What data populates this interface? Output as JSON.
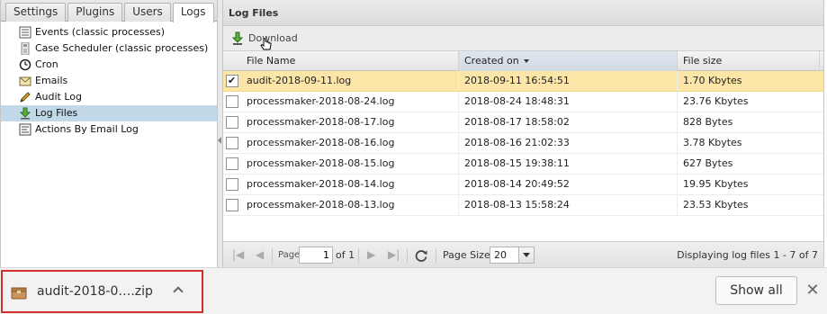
{
  "tabs": [
    "Settings",
    "Plugins",
    "Users",
    "Logs"
  ],
  "active_tab": "Logs",
  "tree": [
    {
      "label": "Events (classic processes)",
      "icon": "events-list-icon"
    },
    {
      "label": "Case Scheduler (classic processes)",
      "icon": "scheduler-icon"
    },
    {
      "label": "Cron",
      "icon": "clock-icon"
    },
    {
      "label": "Emails",
      "icon": "envelope-icon"
    },
    {
      "label": "Audit Log",
      "icon": "pencil-icon"
    },
    {
      "label": "Log Files",
      "icon": "download-icon"
    },
    {
      "label": "Actions By Email Log",
      "icon": "email-log-icon"
    }
  ],
  "selected_tree_item": "Log Files",
  "panel": {
    "title": "Log Files",
    "download_label": "Download"
  },
  "grid": {
    "columns": [
      "File Name",
      "Created on",
      "File size"
    ],
    "rows": [
      {
        "name": "audit-2018-09-11.log",
        "created": "2018-09-11 16:54:51",
        "size": "1.70 Kbytes",
        "checked": true
      },
      {
        "name": "processmaker-2018-08-24.log",
        "created": "2018-08-24 18:48:31",
        "size": "23.76 Kbytes",
        "checked": false
      },
      {
        "name": "processmaker-2018-08-17.log",
        "created": "2018-08-17 18:58:02",
        "size": "828 Bytes",
        "checked": false
      },
      {
        "name": "processmaker-2018-08-16.log",
        "created": "2018-08-16 21:02:33",
        "size": "3.78 Kbytes",
        "checked": false
      },
      {
        "name": "processmaker-2018-08-15.log",
        "created": "2018-08-15 19:38:11",
        "size": "627 Bytes",
        "checked": false
      },
      {
        "name": "processmaker-2018-08-14.log",
        "created": "2018-08-14 20:49:52",
        "size": "19.95 Kbytes",
        "checked": false
      },
      {
        "name": "processmaker-2018-08-13.log",
        "created": "2018-08-13 15:58:24",
        "size": "23.53 Kbytes",
        "checked": false
      }
    ]
  },
  "pager": {
    "page_label": "Page",
    "page_value": "1",
    "of_label": "of 1",
    "page_size_label": "Page Size",
    "page_size_value": "20",
    "status": "Displaying log files 1 - 7 of 7"
  },
  "downloads": {
    "file": "audit-2018-0….zip",
    "show_all": "Show all",
    "close": "✕"
  },
  "colors": {
    "selected_row": "#fbe6a8",
    "selected_tree": "#c1d8e8",
    "highlight_border": "#d32f2f"
  }
}
